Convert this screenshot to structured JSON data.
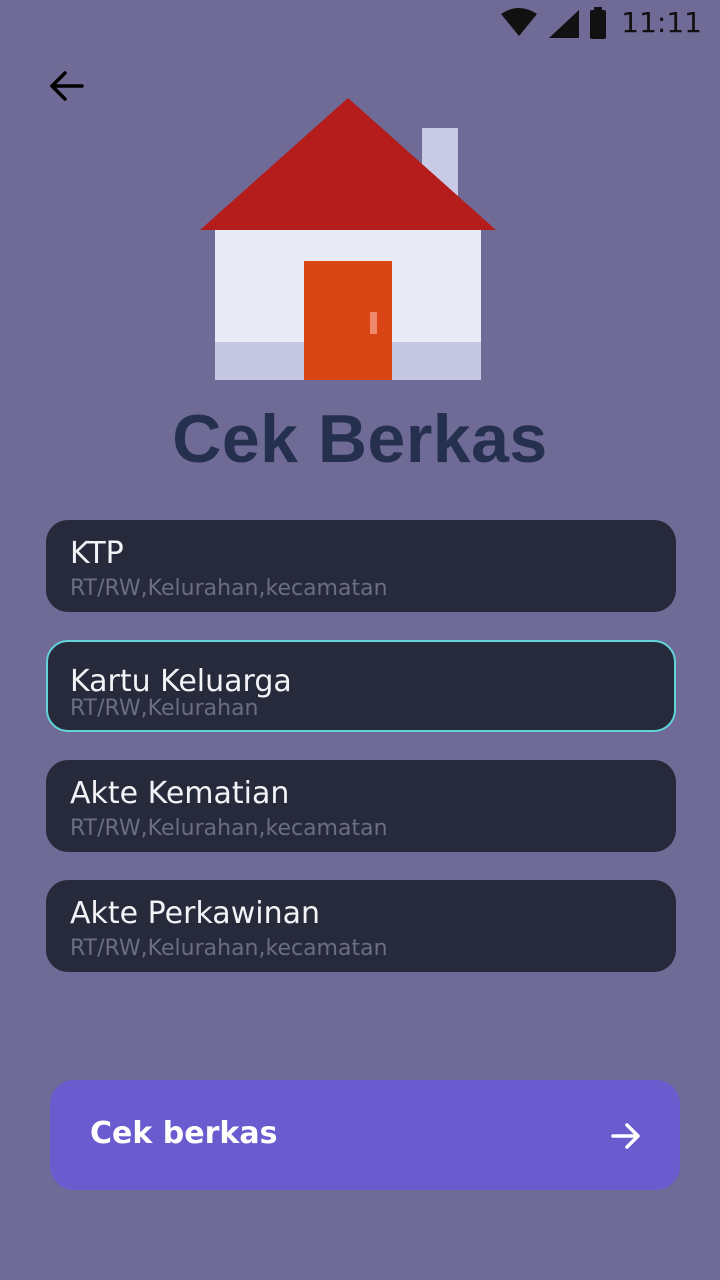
{
  "status_bar": {
    "time": "11:11",
    "icons": [
      "wifi-icon",
      "signal-icon",
      "battery-icon"
    ]
  },
  "header": {
    "back_icon": "arrow-left-icon",
    "illustration": "house-illustration",
    "title": "Cek Berkas"
  },
  "documents": [
    {
      "title": "KTP",
      "subtitle": "RT/RW,Kelurahan,kecamatan",
      "selected": false
    },
    {
      "title": "Kartu Keluarga",
      "subtitle": "RT/RW,Kelurahan",
      "selected": true
    },
    {
      "title": "Akte Kematian",
      "subtitle": "RT/RW,Kelurahan,kecamatan",
      "selected": false
    },
    {
      "title": "Akte Perkawinan",
      "subtitle": "RT/RW,Kelurahan,kecamatan",
      "selected": false
    }
  ],
  "action": {
    "label": "Cek berkas",
    "icon": "arrow-right-icon"
  },
  "colors": {
    "background": "#6f6a96",
    "card": "#262a3a",
    "selected_border": "#62d3da",
    "button": "#6a5ccf",
    "title": "#25304f",
    "roof": "#b51c1c",
    "door": "#d94515"
  }
}
